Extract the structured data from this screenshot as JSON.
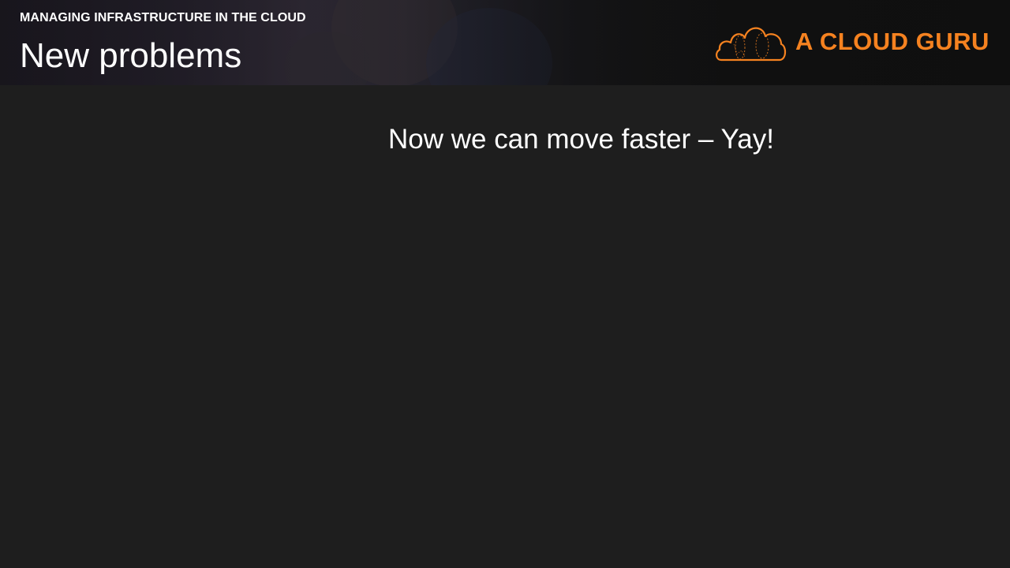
{
  "header": {
    "course_title": "MANAGING INFRASTRUCTURE IN THE CLOUD",
    "section_title": "New problems"
  },
  "logo": {
    "icon": "cloud-icon",
    "text": "A CLOUD GURU",
    "color": "#f58220"
  },
  "body": {
    "text": "Now we can move faster – Yay!"
  },
  "colors": {
    "background": "#1e1e1e",
    "header_background": "#111111",
    "text": "#ffffff",
    "accent": "#f58220"
  }
}
